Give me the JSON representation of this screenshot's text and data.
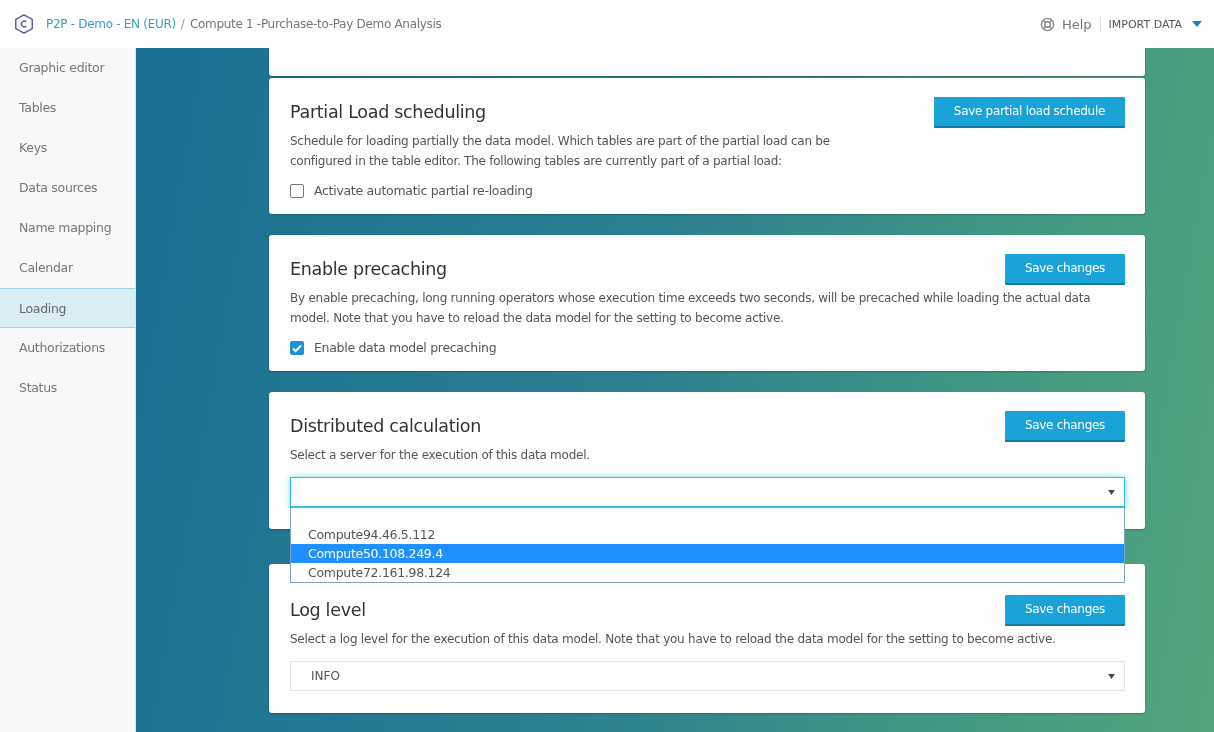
{
  "header": {
    "breadcrumb_link": "P2P - Demo - EN (EUR)",
    "separator": "/",
    "breadcrumb_current": "Compute 1 -Purchase-to-Pay Demo Analysis",
    "help": "Help",
    "import": "IMPORT DATA"
  },
  "sidebar": {
    "items": [
      {
        "label": "Graphic editor",
        "selected": false
      },
      {
        "label": "Tables",
        "selected": false
      },
      {
        "label": "Keys",
        "selected": false
      },
      {
        "label": "Data sources",
        "selected": false
      },
      {
        "label": "Name mapping",
        "selected": false
      },
      {
        "label": "Calendar",
        "selected": false
      },
      {
        "label": "Loading",
        "selected": true
      },
      {
        "label": "Authorizations",
        "selected": false
      },
      {
        "label": "Status",
        "selected": false
      }
    ]
  },
  "sections": [
    {
      "kind": "checkbox",
      "title": "Partial Load scheduling",
      "button": "Save partial load schedule",
      "description": "Schedule for loading partially the data model. Which tables are part of the partial load can be configured in the table editor. The following tables are currently part of a partial load:",
      "checkbox": {
        "label": "Activate automatic partial re-loading",
        "checked": false
      }
    },
    {
      "kind": "checkbox",
      "title": "Enable precaching",
      "button": "Save changes",
      "description": "By enable precaching, long running operators whose execution time exceeds two seconds, will be precached while loading the actual data model. Note that you have to reload the data model for the setting to become active.",
      "checkbox": {
        "label": "Enable data model precaching",
        "checked": true
      }
    },
    {
      "kind": "select",
      "title": "Distributed calculation",
      "button": "Save changes",
      "description": "Select a server for the execution of this data model.",
      "select": {
        "expanded": true,
        "options": [
          {
            "label": "Compute94.46.5.112",
            "selected": false
          },
          {
            "label": "Compute50.108.249.4",
            "selected": true
          },
          {
            "label": "Compute72.161.98.124",
            "selected": false
          }
        ]
      }
    },
    {
      "kind": "select",
      "title": "Log level",
      "button": "Save changes",
      "description": "Select a log level for the execution of this data model. Note that you have to reload the data model for the setting to become active.",
      "select": {
        "value": "INFO",
        "expanded": false
      }
    }
  ]
}
